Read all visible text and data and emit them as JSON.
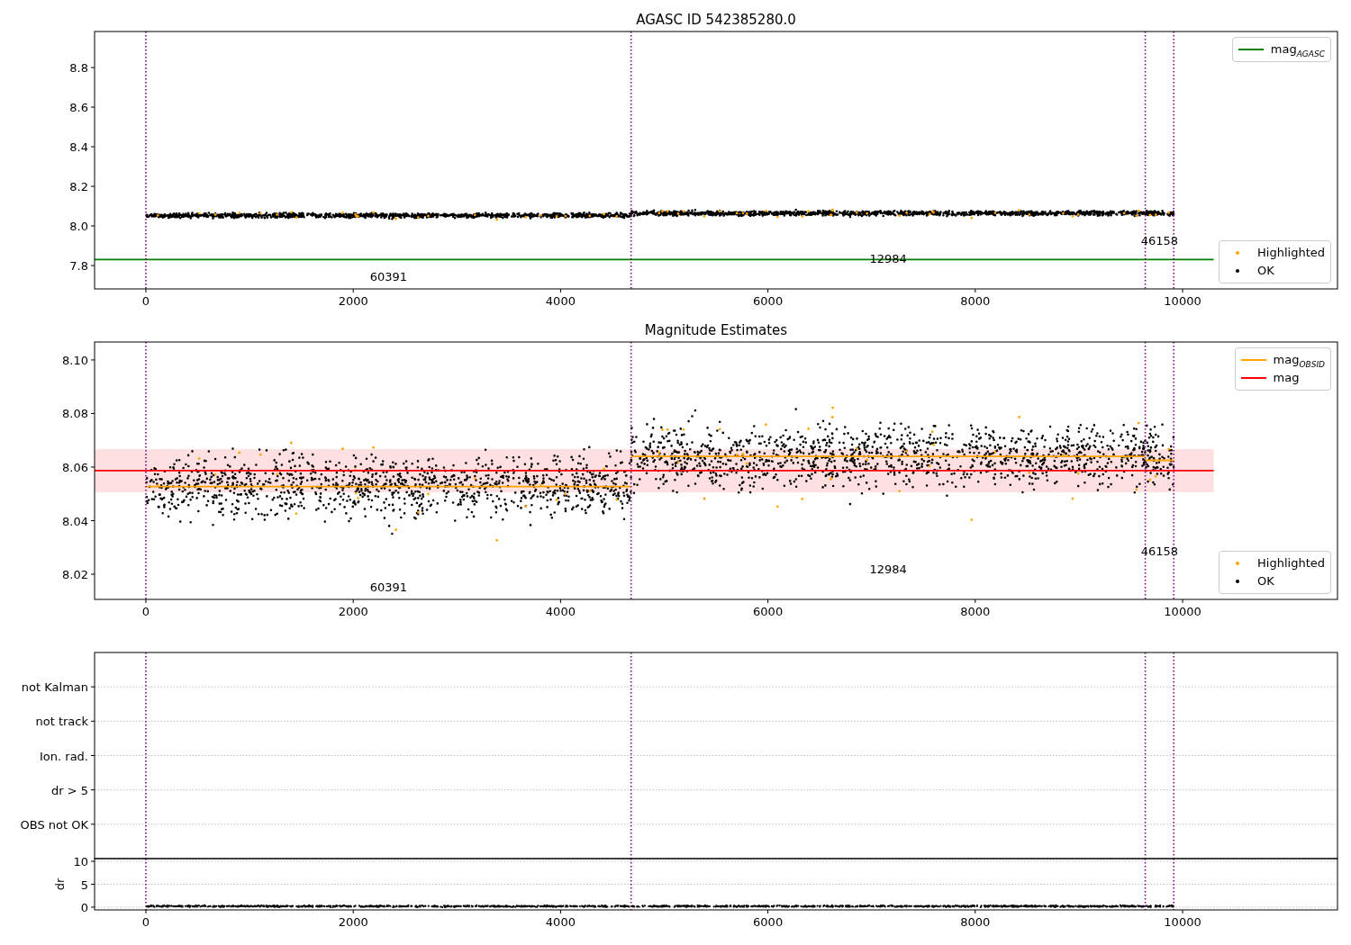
{
  "figure": {
    "panels": [
      {
        "chart_data": {
          "type": "line",
          "title": "AGASC ID 542385280.0",
          "xlim": [
            -495,
            11494
          ],
          "ylim": [
            7.682,
            8.982
          ],
          "xticks": [
            0,
            2000,
            4000,
            6000,
            8000,
            10000
          ],
          "yticks": [
            {
              "value": 7.8,
              "label": "7.8"
            },
            {
              "value": 8.0,
              "label": "8.0"
            },
            {
              "value": 8.2,
              "label": "8.2"
            },
            {
              "value": 8.4,
              "label": "8.4"
            },
            {
              "value": 8.6,
              "label": "8.6"
            },
            {
              "value": 8.8,
              "label": "8.8"
            }
          ],
          "x": [
            -495,
            10300
          ],
          "series": [
            {
              "name": "mag$_{AGASC}$",
              "color": "#008000",
              "values": [
                7.83,
                7.83
              ]
            }
          ],
          "ref_lines": [
            {
              "axis": "x",
              "value": 0,
              "color": "#800080"
            },
            {
              "axis": "x",
              "value": 4680,
              "color": "#800080"
            },
            {
              "axis": "x",
              "value": 9640,
              "color": "#800080"
            },
            {
              "axis": "x",
              "value": 9915,
              "color": "#800080"
            }
          ],
          "annotations": [
            "60391",
            "12984",
            "46158"
          ]
        },
        "legends": [
          {
            "entries": [
              {
                "label": "Highlighted",
                "kind": "dot",
                "color": "#ffa500"
              },
              {
                "label": "OK",
                "kind": "dot",
                "color": "#000000"
              }
            ]
          }
        ]
      },
      {
        "chart_data": {
          "type": "line",
          "title": "Magnitude Estimates",
          "xlim": [
            -495,
            11494
          ],
          "ylim": [
            8.0106,
            8.1067
          ],
          "xticks": [
            0,
            2000,
            4000,
            6000,
            8000,
            10000
          ],
          "yticks": [
            {
              "value": 8.02,
              "label": "8.02"
            },
            {
              "value": 8.04,
              "label": "8.04"
            },
            {
              "value": 8.06,
              "label": "8.06"
            },
            {
              "value": 8.08,
              "label": "8.08"
            },
            {
              "value": 8.1,
              "label": "8.10"
            }
          ],
          "x": [
            -495,
            0,
            4680,
            4680,
            4680,
            9640,
            9640,
            9640,
            9915,
            10300
          ],
          "series": [
            {
              "name": "mag$_{OBSID}$",
              "color": "#ffa500",
              "values": [
                null,
                8.0527,
                8.0527,
                null,
                8.064,
                8.064,
                null,
                8.0625,
                8.0625,
                null
              ]
            },
            {
              "name": "mag",
              "color": "#ff0000",
              "values": [
                8.0587,
                8.0587,
                8.0587,
                8.0587,
                8.0587,
                8.0587,
                8.0587,
                8.0587,
                8.0587,
                8.0587
              ]
            }
          ],
          "bands": [
            {
              "axis": "y",
              "from": 8.0506,
              "to": 8.0667,
              "color": "#ff0000"
            }
          ],
          "ref_lines": [
            {
              "axis": "x",
              "value": 0,
              "color": "#800080"
            },
            {
              "axis": "x",
              "value": 4680,
              "color": "#800080"
            },
            {
              "axis": "x",
              "value": 9640,
              "color": "#800080"
            },
            {
              "axis": "x",
              "value": 9915,
              "color": "#800080"
            }
          ],
          "annotations": [
            "60391",
            "12984",
            "46158"
          ]
        },
        "legends": [
          {
            "entries": [
              {
                "label": "Highlighted",
                "kind": "dot",
                "color": "#ffa500"
              },
              {
                "label": "OK",
                "kind": "dot",
                "color": "#000000"
              }
            ]
          }
        ]
      },
      {
        "chart_data": {
          "type": "scatter",
          "orientation": "horizontal",
          "xlim": [
            -495,
            11494
          ],
          "grid": true,
          "categories": [
            "not Kalman",
            "not track",
            "Ion. rad.",
            "dr > 5",
            "OBS not OK"
          ],
          "ref_lines": [
            {
              "axis": "x",
              "value": 0,
              "color": "#800080"
            },
            {
              "axis": "x",
              "value": 4680,
              "color": "#800080"
            },
            {
              "axis": "x",
              "value": 9640,
              "color": "#800080"
            },
            {
              "axis": "x",
              "value": 9915,
              "color": "#800080"
            }
          ]
        }
      },
      {
        "chart_data": {
          "type": "scatter",
          "ylabel": "dr",
          "xlim": [
            -495,
            11494
          ],
          "ylim": [
            -0.6,
            10.6
          ],
          "grid": true,
          "xticks": [
            0,
            2000,
            4000,
            6000,
            8000,
            10000
          ],
          "yticks": [
            0,
            5,
            10
          ],
          "ref_lines": [
            {
              "axis": "x",
              "value": 0,
              "color": "#800080"
            },
            {
              "axis": "x",
              "value": 4680,
              "color": "#800080"
            },
            {
              "axis": "x",
              "value": 9640,
              "color": "#800080"
            },
            {
              "axis": "x",
              "value": 9915,
              "color": "#800080"
            }
          ]
        }
      }
    ]
  }
}
